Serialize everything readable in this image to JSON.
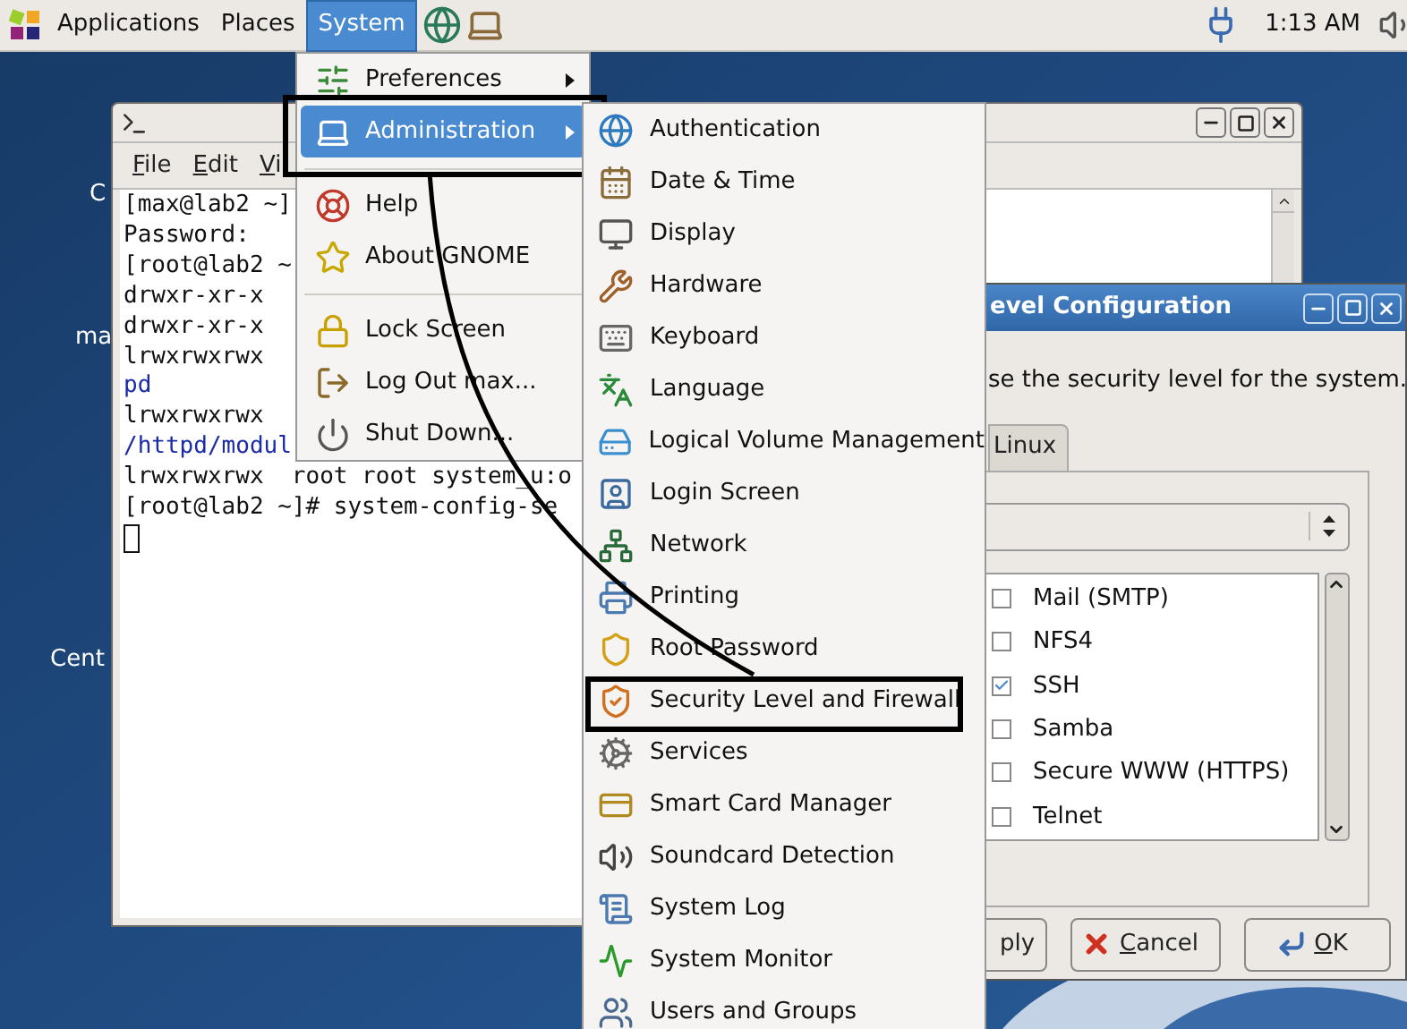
{
  "top_panel": {
    "menus": [
      {
        "label": "Applications",
        "selected": false
      },
      {
        "label": "Places",
        "selected": false
      },
      {
        "label": "System",
        "selected": true
      }
    ],
    "clock": "1:13 AM"
  },
  "desktop_icons": [
    {
      "label": "C"
    },
    {
      "label": "ma"
    },
    {
      "label": "Cent"
    }
  ],
  "terminal": {
    "menu": [
      {
        "label": "File",
        "mnemonic": true
      },
      {
        "label": "Edit",
        "mnemonic": true
      },
      {
        "label": "Vi",
        "mnemonic": true
      }
    ],
    "lines": [
      {
        "text": "[max@lab2 ~]",
        "kind": "plain"
      },
      {
        "text": "Password:",
        "kind": "plain"
      },
      {
        "text": "[root@lab2 ~",
        "kind": "plain"
      },
      {
        "text": "drwxr-xr-x",
        "kind": "plain"
      },
      {
        "text": "drwxr-xr-x",
        "kind": "plain"
      },
      {
        "text": "lrwxrwxrwx",
        "kind": "plain"
      },
      {
        "text": "pd",
        "kind": "link"
      },
      {
        "text": "lrwxrwxrwx",
        "kind": "plain"
      },
      {
        "text": "/httpd/modul",
        "kind": "link"
      },
      {
        "text": "lrwxrwxrwx  root root system_u:o",
        "kind": "plain"
      },
      {
        "text": "[root@lab2 ~]# system-config-se",
        "kind": "plain"
      }
    ]
  },
  "system_menu": {
    "items": [
      {
        "kind": "item",
        "label": "Preferences",
        "submenu": true,
        "selected": false,
        "boxed": false
      },
      {
        "kind": "item",
        "label": "Administration",
        "submenu": true,
        "selected": true,
        "boxed": true
      },
      {
        "kind": "separator"
      },
      {
        "kind": "item",
        "label": "Help",
        "submenu": false,
        "selected": false,
        "boxed": false
      },
      {
        "kind": "item",
        "label": "About GNOME",
        "submenu": false,
        "selected": false,
        "boxed": false
      },
      {
        "kind": "separator"
      },
      {
        "kind": "item",
        "label": "Lock Screen",
        "submenu": false,
        "selected": false,
        "boxed": false
      },
      {
        "kind": "item",
        "label": "Log Out max...",
        "submenu": false,
        "selected": false,
        "boxed": false
      },
      {
        "kind": "item",
        "label": "Shut Down...",
        "submenu": false,
        "selected": false,
        "boxed": false
      }
    ]
  },
  "administration_menu": {
    "items": [
      {
        "label": "Authentication",
        "boxed": false
      },
      {
        "label": "Date & Time",
        "boxed": false
      },
      {
        "label": "Display",
        "boxed": false
      },
      {
        "label": "Hardware",
        "boxed": false
      },
      {
        "label": "Keyboard",
        "boxed": false
      },
      {
        "label": "Language",
        "boxed": false
      },
      {
        "label": "Logical Volume Management",
        "boxed": false
      },
      {
        "label": "Login Screen",
        "boxed": false
      },
      {
        "label": "Network",
        "boxed": false
      },
      {
        "label": "Printing",
        "boxed": false
      },
      {
        "label": "Root Password",
        "boxed": false
      },
      {
        "label": "Security Level and Firewall",
        "boxed": true
      },
      {
        "label": "Services",
        "boxed": false
      },
      {
        "label": "Smart Card Manager",
        "boxed": false
      },
      {
        "label": "Soundcard Detection",
        "boxed": false
      },
      {
        "label": "System Log",
        "boxed": false
      },
      {
        "label": "System Monitor",
        "boxed": false
      },
      {
        "label": "Users and Groups",
        "boxed": false
      }
    ]
  },
  "dialog": {
    "title": "evel Configuration",
    "description": "se the security level for the system.",
    "tab": {
      "label": "Linux",
      "selected": false
    },
    "services": [
      {
        "label": "Mail (SMTP)",
        "checked": false
      },
      {
        "label": "NFS4",
        "checked": false
      },
      {
        "label": "SSH",
        "checked": true
      },
      {
        "label": "Samba",
        "checked": false
      },
      {
        "label": "Secure WWW (HTTPS)",
        "checked": false
      },
      {
        "label": "Telnet",
        "checked": false
      }
    ],
    "buttons": [
      {
        "label": "ply",
        "kind": "apply",
        "mnemonic": false
      },
      {
        "label": "Cancel",
        "kind": "cancel",
        "mnemonic": true
      },
      {
        "label": "OK",
        "kind": "ok",
        "mnemonic": true
      }
    ]
  }
}
